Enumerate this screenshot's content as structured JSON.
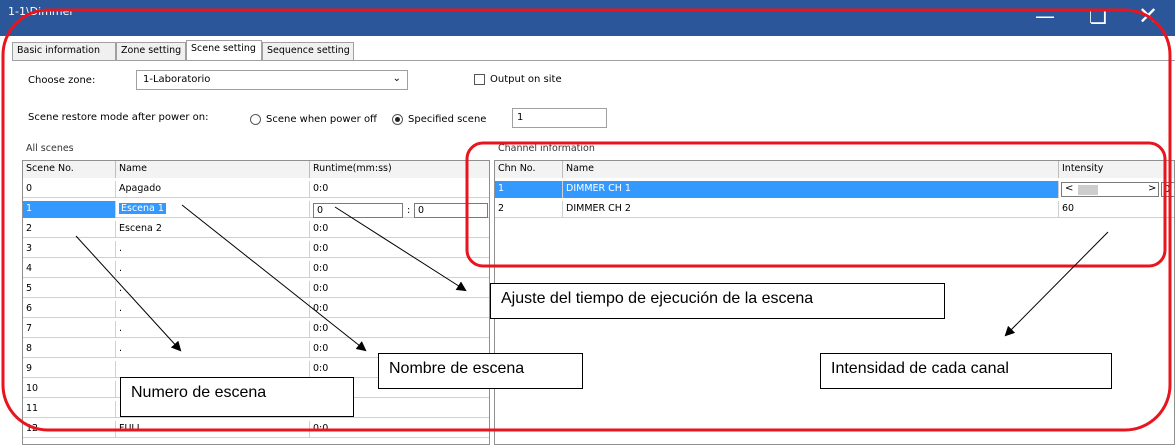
{
  "window": {
    "title": "1-1\\Dimmer",
    "minimize_icon": "minimize-icon",
    "restore_icon": "restore-icon",
    "close_icon": "close-icon"
  },
  "tabs": [
    "Basic information",
    "Zone setting",
    "Scene setting",
    "Sequence setting"
  ],
  "zone": {
    "label": "Choose zone:",
    "value": "1-Laboratorio",
    "output_label": "Output on site"
  },
  "restore": {
    "label": "Scene restore mode after power on:",
    "option1": "Scene when power off",
    "option2": "Specified scene",
    "value": "1"
  },
  "all_scenes": {
    "group": "All scenes",
    "headers": [
      "Scene No.",
      "Name",
      "Runtime(mm:ss)"
    ],
    "rows": [
      [
        "0",
        "Apagado",
        "0:0"
      ],
      [
        "1",
        "Escena 1",
        ""
      ],
      [
        "2",
        "Escena 2",
        "0:0"
      ],
      [
        "3",
        ".",
        "0:0"
      ],
      [
        "4",
        ".",
        "0:0"
      ],
      [
        "5",
        ".",
        "0:0"
      ],
      [
        "6",
        ".",
        "0:0"
      ],
      [
        "7",
        ".",
        "0:0"
      ],
      [
        "8",
        ".",
        "0:0"
      ],
      [
        "9",
        "",
        "0:0"
      ],
      [
        "10",
        "",
        ""
      ],
      [
        "11",
        "",
        ""
      ],
      [
        "12",
        "FULL",
        "0:0"
      ]
    ],
    "runtime_edit": {
      "min": "0",
      "sep": ":",
      "sec": "0"
    }
  },
  "channels": {
    "group": "Channel information",
    "headers": [
      "Chn No.",
      "Name",
      "Intensity"
    ],
    "rows": [
      [
        "1",
        "DIMMER CH 1",
        ""
      ],
      [
        "2",
        "DIMMER CH 2",
        "60"
      ]
    ],
    "slider_value": "0"
  },
  "annotations": {
    "runtime": "Ajuste del tiempo de ejecución de la escena",
    "scene_name": "Nombre de escena",
    "intensity": "Intensidad de cada canal",
    "scene_number": "Numero de escena"
  },
  "colors": {
    "titlebar": "#2b579a",
    "selection": "#3399ff",
    "highlight_outline": "#e8141e"
  }
}
